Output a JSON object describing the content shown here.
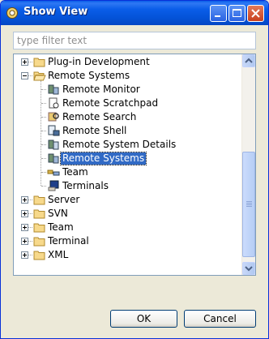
{
  "window": {
    "title": "Show View"
  },
  "filter": {
    "placeholder": "type filter text",
    "value": ""
  },
  "tree": {
    "items": [
      {
        "label": "Plug-in Development",
        "icon": "folder-icon",
        "level": 0,
        "expander": "plus"
      },
      {
        "label": "Remote Systems",
        "icon": "folder-open-icon",
        "level": 0,
        "expander": "minus"
      },
      {
        "label": "Remote Monitor",
        "icon": "remote-monitor-icon",
        "level": 1
      },
      {
        "label": "Remote Scratchpad",
        "icon": "scratchpad-icon",
        "level": 1
      },
      {
        "label": "Remote Search",
        "icon": "remote-search-icon",
        "level": 1
      },
      {
        "label": "Remote Shell",
        "icon": "remote-shell-icon",
        "level": 1
      },
      {
        "label": "Remote System Details",
        "icon": "system-details-icon",
        "level": 1
      },
      {
        "label": "Remote Systems",
        "icon": "remote-systems-icon",
        "level": 1,
        "selected": true
      },
      {
        "label": "Team",
        "icon": "team-icon",
        "level": 1
      },
      {
        "label": "Terminals",
        "icon": "terminals-icon",
        "level": 1
      },
      {
        "label": "Server",
        "icon": "folder-icon",
        "level": 0,
        "expander": "plus"
      },
      {
        "label": "SVN",
        "icon": "folder-icon",
        "level": 0,
        "expander": "plus"
      },
      {
        "label": "Team",
        "icon": "folder-icon",
        "level": 0,
        "expander": "plus"
      },
      {
        "label": "Terminal",
        "icon": "folder-icon",
        "level": 0,
        "expander": "plus"
      },
      {
        "label": "XML",
        "icon": "folder-icon",
        "level": 0,
        "expander": "plus"
      }
    ]
  },
  "buttons": {
    "ok": "OK",
    "cancel": "Cancel"
  },
  "colors": {
    "selection": "#316ac5",
    "titlebar": "#0a5de8"
  }
}
